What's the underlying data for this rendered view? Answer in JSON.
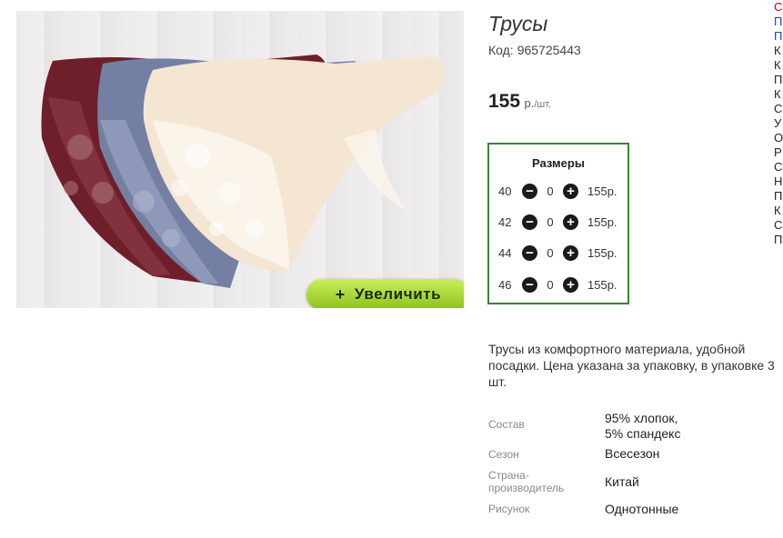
{
  "product": {
    "title": "Трусы",
    "code_label": "Код:",
    "code": "965725443",
    "price": "155",
    "price_unit": "р.",
    "price_per": "/шт.",
    "zoom_label": "Увеличить",
    "zoom_icon": "+",
    "description": "Трусы из комфортного материала, удобной посадки. Цена указана за упаковку, в упаковке 3 шт."
  },
  "sizes": {
    "heading": "Размеры",
    "rows": [
      {
        "size": "40",
        "qty": "0",
        "price": "155р."
      },
      {
        "size": "42",
        "qty": "0",
        "price": "155р."
      },
      {
        "size": "44",
        "qty": "0",
        "price": "155р."
      },
      {
        "size": "46",
        "qty": "0",
        "price": "155р."
      }
    ]
  },
  "properties": [
    {
      "key": "Состав",
      "value": "95% хлопок,\n5% спандекс"
    },
    {
      "key": "Сезон",
      "value": "Всесезон"
    },
    {
      "key": "Страна-производитель",
      "value": "Китай"
    },
    {
      "key": "Рисунок",
      "value": "Однотонные"
    }
  ],
  "right_column": {
    "letters": [
      "С",
      "П",
      "П",
      "К",
      "К",
      "П",
      "К",
      "С",
      "У",
      "О",
      "Р",
      "С",
      "Н",
      "П",
      "К",
      "С",
      "П"
    ],
    "colors": [
      "#d00000",
      "#1a3fcf",
      "#1a3fcf",
      "#222",
      "#222",
      "#222",
      "#222",
      "#222",
      "#222",
      "#222",
      "#222",
      "#222",
      "#222",
      "#222",
      "#222",
      "#222",
      "#222"
    ]
  },
  "colors": {
    "sizes_border": "#2e8b2e",
    "zoom_button": "#a6d82f"
  }
}
